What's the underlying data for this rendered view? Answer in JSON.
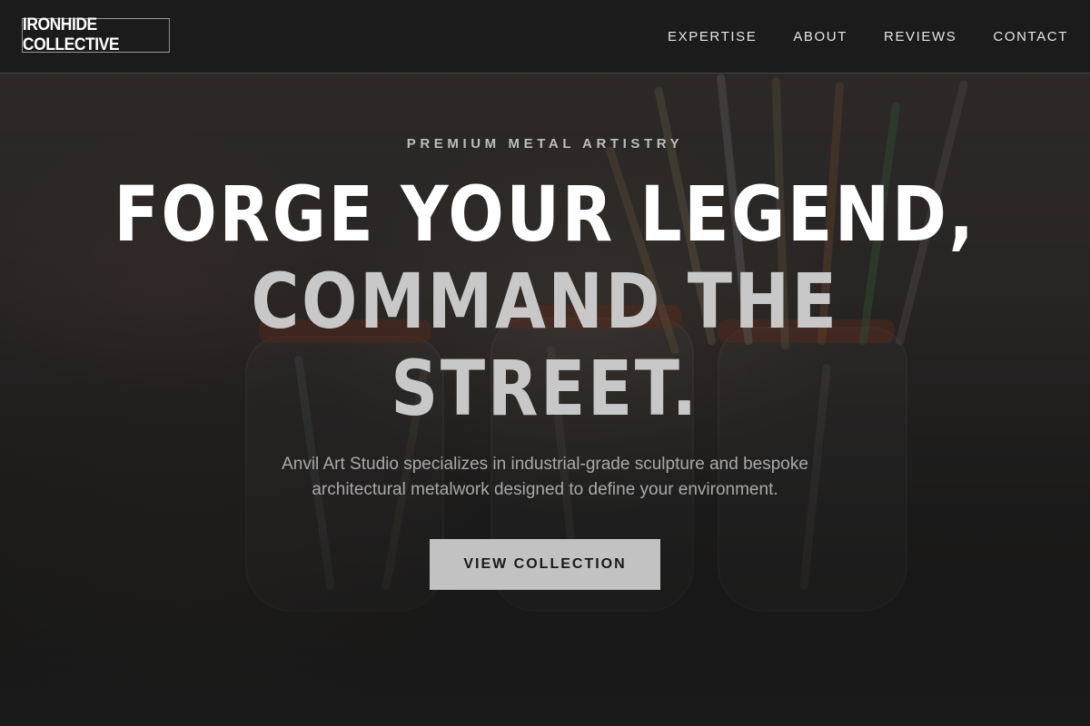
{
  "brand": {
    "name": "IRONHIDE COLLECTIVE"
  },
  "nav": {
    "items": [
      {
        "label": "EXPERTISE"
      },
      {
        "label": "ABOUT"
      },
      {
        "label": "REVIEWS"
      },
      {
        "label": "CONTACT"
      }
    ]
  },
  "hero": {
    "eyebrow": "PREMIUM METAL ARTISTRY",
    "headline_line1": "FORGE YOUR LEGEND,",
    "headline_line2": "COMMAND THE",
    "headline_line3": "STREET.",
    "subtitle_line1": "Anvil Art Studio specializes in industrial-grade sculpture and bespoke",
    "subtitle_line2": "architectural metalwork designed to define your environment.",
    "cta_label": "VIEW COLLECTION"
  },
  "colors": {
    "header_bg": "#1a1a1a",
    "button_bg": "#c2c2c2",
    "headline_primary": "#ffffff",
    "headline_secondary": "#c8c8c8"
  }
}
